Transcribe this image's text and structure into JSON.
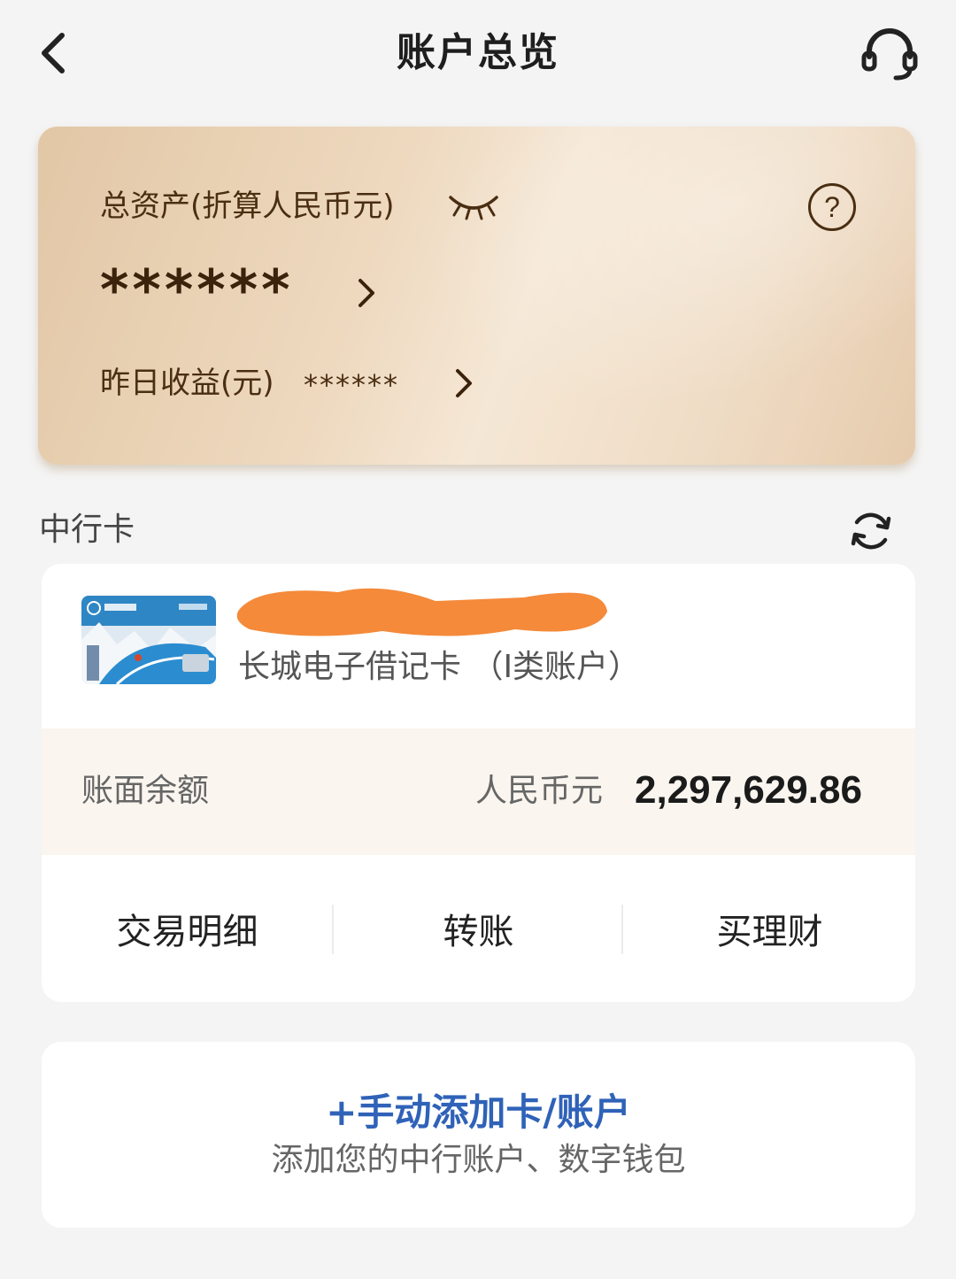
{
  "header": {
    "title": "账户总览",
    "back_icon": "chevron-left-icon",
    "service_icon": "headset-icon"
  },
  "asset_card": {
    "total_label": "总资产(折算人民币元)",
    "total_value": "******",
    "yesterday_label": "昨日收益(元)",
    "yesterday_value": "******",
    "visibility_icon": "eye-closed-icon",
    "help_icon": "question-circle-icon",
    "help_glyph": "?"
  },
  "section": {
    "title": "中行卡",
    "refresh_icon": "refresh-icon"
  },
  "card": {
    "name": "长城电子借记卡 （I类账户）",
    "balance_label": "账面余额",
    "currency": "人民币元",
    "balance": "2,297,629.86",
    "actions": [
      "交易明细",
      "转账",
      "买理财"
    ]
  },
  "add_account": {
    "link": "+手动添加卡/账户",
    "subtitle": "添加您的中行账户、数字钱包"
  },
  "colors": {
    "link_blue": "#2f62b8",
    "card_gold": "#e9d2b4",
    "redaction_orange": "#f48a3a"
  }
}
